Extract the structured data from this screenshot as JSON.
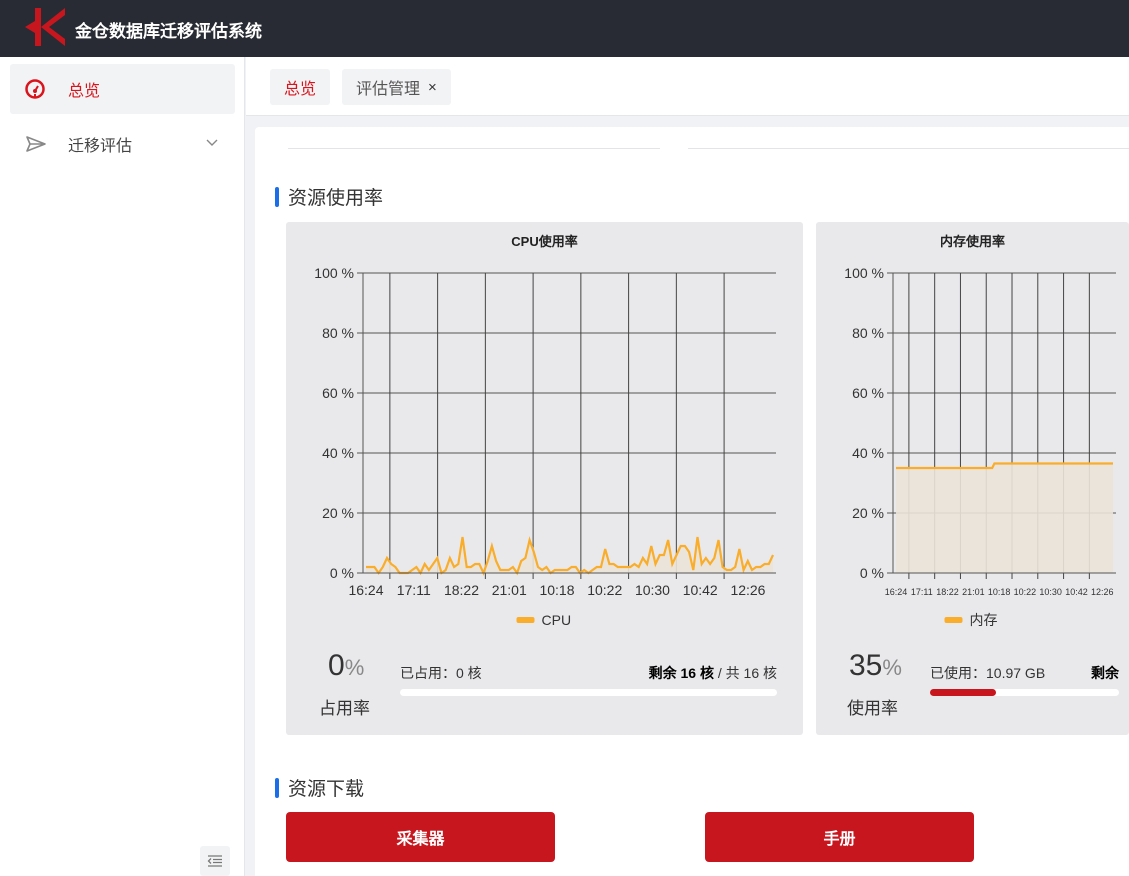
{
  "app": {
    "title": "金仓数据库迁移评估系统",
    "logo_text": "K"
  },
  "sidebar": {
    "items": [
      {
        "label": "总览",
        "icon": "dashboard-icon",
        "active": true
      },
      {
        "label": "迁移评估",
        "icon": "send-icon",
        "expandable": true
      }
    ]
  },
  "tabs": [
    {
      "label": "总览",
      "active": true
    },
    {
      "label": "评估管理",
      "closable": true,
      "close": "×"
    }
  ],
  "sections": {
    "usage": "资源使用率",
    "download": "资源下载"
  },
  "colors": {
    "accent": "#c8161e",
    "series": "#f9ad2b",
    "section_bar": "#1a6ee8",
    "header": "#282b33"
  },
  "cpu": {
    "percent_value": "0",
    "percent_sign": "%",
    "percent_label": "占用率",
    "used": "已占用：0 核",
    "remaining": "剩余 16 核",
    "sep": " / ",
    "total": "共 16 核",
    "progress": 0
  },
  "memory": {
    "percent_value": "35",
    "percent_sign": "%",
    "percent_label": "使用率",
    "used": "已使用：10.97 GB",
    "remaining": "剩余",
    "progress": 35
  },
  "downloads": {
    "collector": "采集器",
    "manual": "手册"
  },
  "chart_data": [
    {
      "type": "area",
      "title": "CPU使用率",
      "legend": "CPU",
      "legend_position": "bottom",
      "ylim": [
        0,
        100
      ],
      "yticks": [
        "0 %",
        "20 %",
        "40 %",
        "60 %",
        "80 %",
        "100 %"
      ],
      "xticks": [
        "16:24",
        "17:11",
        "18:22",
        "21:01",
        "10:18",
        "10:22",
        "10:30",
        "10:42",
        "12:26"
      ],
      "grid": true,
      "series": [
        {
          "name": "CPU",
          "values": [
            2,
            2,
            2,
            0,
            2,
            5,
            3,
            2,
            0,
            0,
            0,
            1,
            2,
            0,
            3,
            1,
            3,
            5,
            0,
            1,
            5,
            2,
            3,
            12,
            2,
            2,
            3,
            3,
            0,
            4,
            9,
            4,
            1,
            1,
            1,
            2,
            0,
            4,
            5,
            11,
            7,
            2,
            1,
            2,
            0,
            1,
            1,
            1,
            1,
            2,
            2,
            0,
            1,
            0,
            1,
            2,
            2,
            8,
            3,
            3,
            2,
            2,
            2,
            2,
            3,
            2,
            5,
            3,
            9,
            3,
            6,
            6,
            11,
            3,
            6,
            9,
            9,
            7,
            1,
            12,
            3,
            5,
            3,
            5,
            11,
            2,
            1,
            1,
            2,
            8,
            1,
            4,
            1,
            2,
            2,
            3,
            3,
            6
          ]
        }
      ]
    },
    {
      "type": "area",
      "title": "内存使用率",
      "legend": "内存",
      "legend_position": "bottom",
      "ylim": [
        0,
        100
      ],
      "yticks": [
        "0 %",
        "20 %",
        "40 %",
        "60 %",
        "80 %",
        "100 %"
      ],
      "xticks": [
        "16:24",
        "17:11",
        "18:22",
        "21:01",
        "10:18",
        "10:22",
        "10:30",
        "10:42",
        "12:26"
      ],
      "grid": true,
      "series": [
        {
          "name": "内存",
          "values": [
            35,
            35,
            35,
            35,
            35,
            35,
            35,
            35,
            35,
            35,
            35,
            35,
            35,
            35,
            35,
            35,
            35,
            35,
            35,
            35,
            35,
            35,
            35,
            35,
            35,
            35,
            35,
            35,
            35,
            35,
            35,
            35,
            35,
            35,
            35,
            35,
            35,
            35,
            35,
            35,
            35,
            35,
            35,
            35,
            36.5,
            36.5,
            36.5,
            36.5,
            36.5,
            36.5,
            36.5,
            36.5,
            36.5,
            36.5,
            36.5,
            36.5,
            36.5,
            36.5,
            36.5,
            36.5,
            36.5,
            36.5,
            36.5,
            36.5,
            36.5,
            36.5,
            36.5,
            36.5,
            36.5,
            36.5,
            36.5,
            36.5,
            36.5,
            36.5,
            36.5,
            36.5,
            36.5,
            36.5,
            36.5,
            36.5,
            36.5,
            36.5,
            36.5,
            36.5,
            36.5,
            36.5,
            36.5,
            36.5,
            36.5,
            36.5,
            36.5,
            36.5,
            36.5,
            36.5,
            36.5,
            36.5,
            36.5,
            36.5
          ]
        }
      ]
    }
  ]
}
